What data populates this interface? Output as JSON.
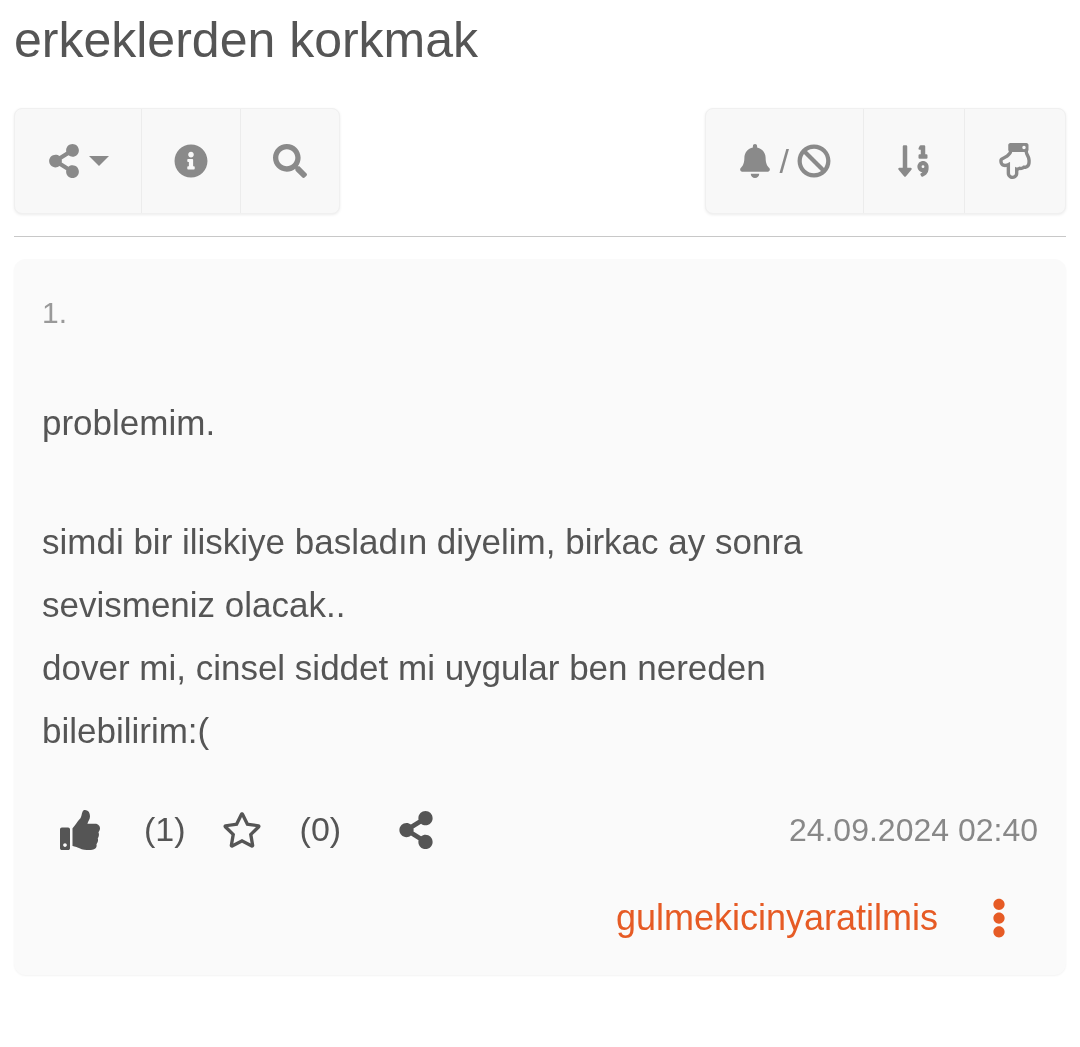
{
  "title": "erkeklerden korkmak",
  "toolbar": {
    "separator": "/"
  },
  "entry": {
    "number": "1.",
    "paragraphs": [
      [
        "problemim."
      ],
      [
        "simdi bir iliskiye basladın diyelim, birkac ay sonra sevismeniz olacak..",
        "dover mi, cinsel siddet mi uygular ben nereden bilebilirim:("
      ]
    ],
    "likes": "(1)",
    "favorites": "(0)",
    "date": "24.09.2024 02:40",
    "author": "gulmekicinyaratilmis"
  }
}
